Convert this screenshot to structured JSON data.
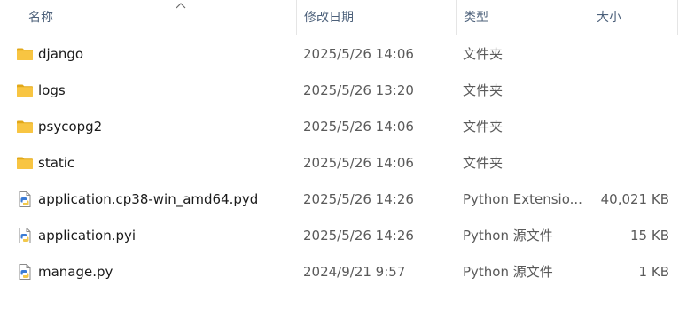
{
  "columns": {
    "name": "名称",
    "date": "修改日期",
    "type": "类型",
    "size": "大小"
  },
  "sort": {
    "column": "name",
    "direction": "ascending",
    "icon": "sort-up-chevron-icon"
  },
  "files": [
    {
      "icon": "folder-icon",
      "name": "django",
      "date": "2025/5/26 14:06",
      "type": "文件夹",
      "size": ""
    },
    {
      "icon": "folder-icon",
      "name": "logs",
      "date": "2025/5/26 13:20",
      "type": "文件夹",
      "size": ""
    },
    {
      "icon": "folder-icon",
      "name": "psycopg2",
      "date": "2025/5/26 14:06",
      "type": "文件夹",
      "size": ""
    },
    {
      "icon": "folder-icon",
      "name": "static",
      "date": "2025/5/26 14:06",
      "type": "文件夹",
      "size": ""
    },
    {
      "icon": "python-file-icon",
      "name": "application.cp38-win_amd64.pyd",
      "date": "2025/5/26 14:26",
      "type": "Python Extensio...",
      "size": "40,021 KB"
    },
    {
      "icon": "python-file-icon",
      "name": "application.pyi",
      "date": "2025/5/26 14:26",
      "type": "Python 源文件",
      "size": "15 KB"
    },
    {
      "icon": "python-file-icon",
      "name": "manage.py",
      "date": "2024/9/21 9:57",
      "type": "Python 源文件",
      "size": "1 KB"
    }
  ],
  "colors": {
    "folder_yellow": "#f8c542",
    "folder_dark": "#e2a818",
    "python_blue": "#3a7bd5",
    "python_yellow": "#f2c84b",
    "header_text": "#4c607a"
  }
}
